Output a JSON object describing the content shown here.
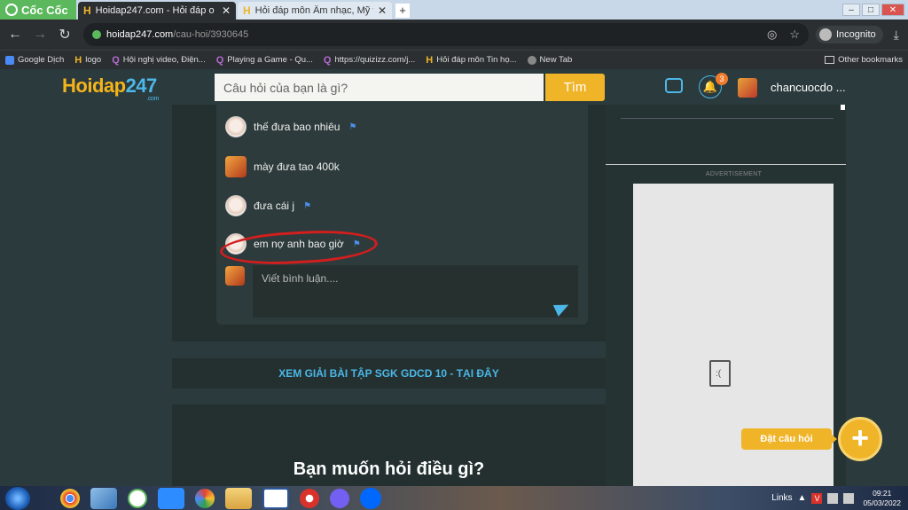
{
  "browser": {
    "brand": "Cốc Cốc",
    "tabs": [
      {
        "title": "Hoidap247.com - Hỏi đáp o",
        "active": true
      },
      {
        "title": "Hỏi đáp môn Âm nhạc, Mỹ tì",
        "active": false
      }
    ],
    "new_tab": "+",
    "url_host": "hoidap247.com",
    "url_path": "/cau-hoi/3930645",
    "incognito_label": "Incognito",
    "bookmarks": [
      {
        "label": "Google Dịch",
        "icon": "google-translate-icon"
      },
      {
        "label": "logo",
        "icon": "hoidap-icon"
      },
      {
        "label": "Hội nghị video, Điện...",
        "icon": "quizizz-icon"
      },
      {
        "label": "Playing a Game - Qu...",
        "icon": "quizizz-icon"
      },
      {
        "label": "https://quizizz.com/j...",
        "icon": "quizizz-icon"
      },
      {
        "label": "Hỏi đáp môn Tin họ...",
        "icon": "hoidap-icon"
      },
      {
        "label": "New Tab",
        "icon": "globe-icon"
      }
    ],
    "other_bookmarks": "Other bookmarks"
  },
  "site": {
    "logo_main": "Hoidap",
    "logo_num": "247",
    "logo_sub": ".com",
    "search_placeholder": "Câu hỏi của bạn là gì?",
    "search_button": "Tìm",
    "notification_count": "3",
    "username": "chancuocdo ..."
  },
  "comments": [
    {
      "text": "thế đưa bao nhiêu",
      "avatar": "girl",
      "flag": true
    },
    {
      "text": "mày đưa tao 400k",
      "avatar": "boy",
      "flag": false
    },
    {
      "text": "đưa cái j",
      "avatar": "girl",
      "flag": true
    },
    {
      "text": "em nợ anh bao giờ",
      "avatar": "girl",
      "flag": true,
      "highlighted": true
    }
  ],
  "reply_placeholder": "Viết bình luận....",
  "gdcd_link": "XEM GIẢI BÀI TẬP SGK GDCD 10 - TẠI ĐÂY",
  "ask_title": "Bạn muốn hỏi điều gì?",
  "sidebar": {
    "ad_label": "ADVERTISEMENT",
    "ask_button": "Đặt câu hỏi"
  },
  "taskbar": {
    "links_label": "Links",
    "time": "09:21",
    "date": "05/03/2022"
  },
  "colors": {
    "accent_yellow": "#f0b429",
    "accent_blue": "#4cb7e8",
    "highlight_red": "#d31e1e",
    "background": "#2b3a3d"
  }
}
